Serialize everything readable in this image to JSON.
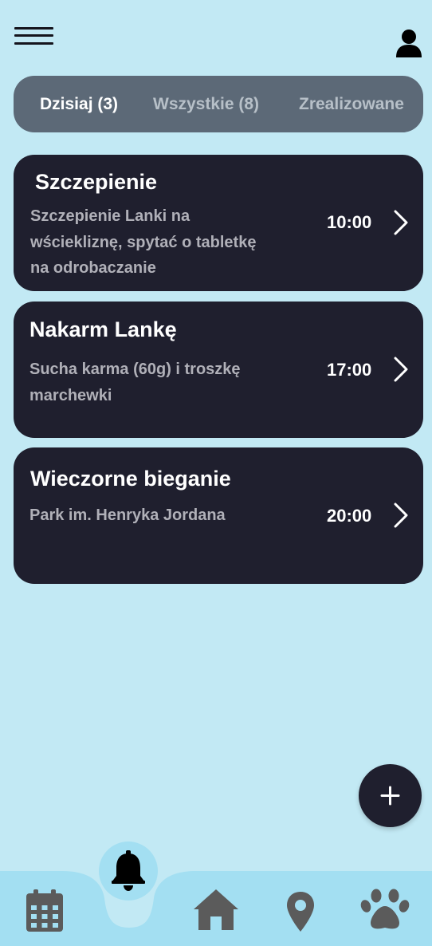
{
  "header": {
    "menu_icon": "hamburger-menu-icon",
    "profile_icon": "user-icon"
  },
  "tabs": [
    {
      "label": "Dzisiaj (3)",
      "active": true
    },
    {
      "label": "Wszystkie (8)",
      "active": false
    },
    {
      "label": "Zrealizowane",
      "active": false
    }
  ],
  "reminders": [
    {
      "title": "Szczepienie",
      "description_lines": [
        "Szczepienie Lanki na",
        "wściekliznę, spytać  o tabletkę",
        "na odrobaczanie"
      ],
      "time": "10:00"
    },
    {
      "title": "Nakarm Lankę",
      "description_lines": [
        "Sucha karma (60g) i troszkę",
        "marchewki"
      ],
      "time": "17:00"
    },
    {
      "title": "Wieczorne bieganie",
      "description_lines": [
        "Park im. Henryka Jordana"
      ],
      "time": "20:00"
    }
  ],
  "fab": {
    "icon": "plus-icon"
  },
  "bottom_nav": {
    "items": [
      "calendar-icon",
      "bell-icon",
      "home-icon",
      "map-pin-icon",
      "paw-icon"
    ],
    "active": "bell-icon"
  },
  "colors": {
    "background": "#c2e9f4",
    "card": "#1f1f2e",
    "tab_bar": "#5c6977",
    "nav_bar": "#a3dff2",
    "icon_gray": "#5b5b5b"
  }
}
